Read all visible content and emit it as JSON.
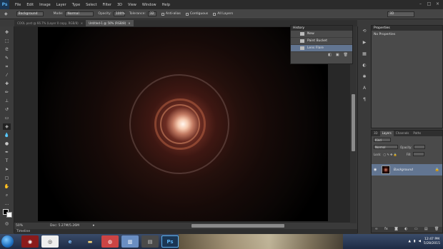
{
  "app": {
    "logo": "Ps"
  },
  "menu": [
    "File",
    "Edit",
    "Image",
    "Layer",
    "Type",
    "Select",
    "Filter",
    "3D",
    "View",
    "Window",
    "Help"
  ],
  "options": {
    "fill_source": "Background",
    "mode_label": "Mode:",
    "mode_value": "Normal",
    "opacity_label": "Opacity:",
    "opacity_value": "100%",
    "tolerance_label": "Tolerance:",
    "tolerance_value": "32",
    "anti_alias": "Anti-alias",
    "contiguous": "Contiguous",
    "all_layers": "All Layers",
    "workspace": "3D"
  },
  "tabs": [
    {
      "label": "COOL post @ 66.7% (Layer 0 copy, RGB/8)"
    },
    {
      "label": "Untitled-1 @ 50% (RGB/8)"
    }
  ],
  "status": {
    "zoom": "50%",
    "doc": "Doc: 5.27M/5.26M"
  },
  "timeline": {
    "label": "Timeline"
  },
  "history": {
    "title": "History",
    "items": [
      {
        "label": "New"
      },
      {
        "label": "Paint Bucket"
      },
      {
        "label": "Lens Flare"
      }
    ]
  },
  "properties": {
    "title": "Properties",
    "body": "No Properties"
  },
  "layers_panel": {
    "tabs": [
      "3D",
      "Layers",
      "Channels",
      "Paths"
    ],
    "kind": "Kind",
    "blend": "Normal",
    "opacity_label": "Opacity:",
    "lock_label": "Lock:",
    "fill_label": "Fill:",
    "layer_name": "Background"
  },
  "taskbar": {
    "time": "12:47 PM",
    "date": "5/28/2015"
  },
  "colors": {
    "accent": "#627591",
    "panel": "#4a4a4a",
    "chrome": "#2b2b2b"
  }
}
